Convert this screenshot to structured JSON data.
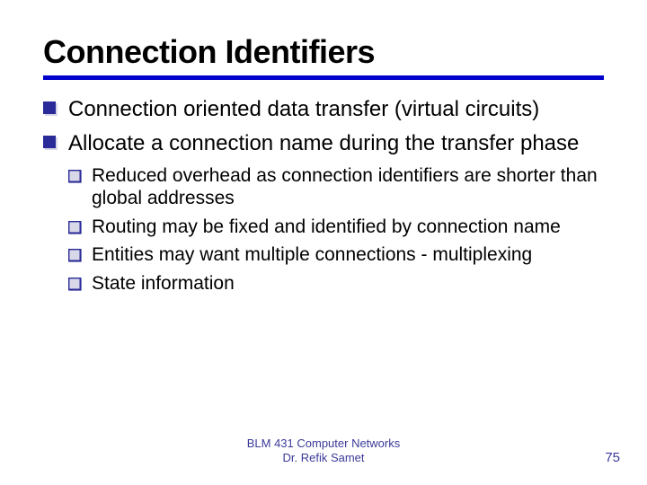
{
  "title": "Connection Identifiers",
  "bullets_level1": [
    "Connection oriented data transfer (virtual circuits)",
    "Allocate a connection name during the transfer phase"
  ],
  "bullets_level2": [
    "Reduced overhead as connection identifiers are shorter than global addresses",
    "Routing may be fixed and identified by connection name",
    "Entities may want multiple connections - multiplexing",
    "State information"
  ],
  "footer_line1": "BLM 431 Computer Networks",
  "footer_line2": "Dr. Refik Samet",
  "page_number": "75"
}
